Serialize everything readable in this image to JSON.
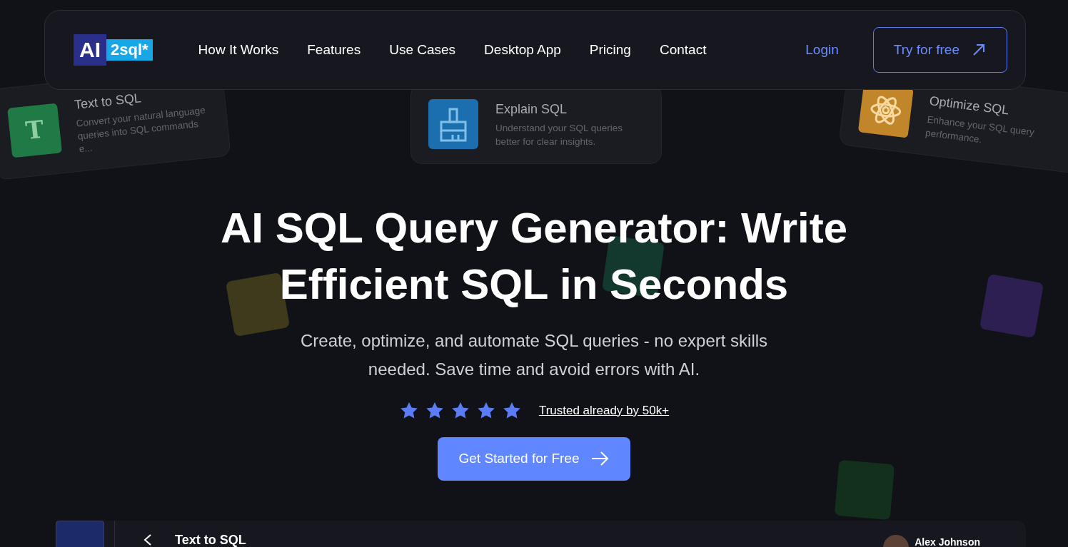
{
  "logo": {
    "part_1": "AI",
    "part_2": "2sql*"
  },
  "nav": {
    "links": [
      {
        "label": "How It Works"
      },
      {
        "label": "Features"
      },
      {
        "label": "Use Cases"
      },
      {
        "label": "Desktop App"
      },
      {
        "label": "Pricing"
      },
      {
        "label": "Contact"
      }
    ],
    "login": "Login",
    "cta": "Try for free"
  },
  "feature_cards": [
    {
      "kind": "letter",
      "glyph": "T",
      "color": "#1f7a45",
      "title": "Text to SQL",
      "description": "Convert your natural language queries into SQL commands e..."
    },
    {
      "kind": "brush",
      "color": "#1b6fae",
      "title": "Explain SQL",
      "description": "Understand your SQL queries better for clear insights."
    },
    {
      "kind": "atom",
      "color": "#c2862a",
      "title": "Optimize SQL",
      "description": "Enhance your SQL query performance."
    }
  ],
  "background_tiles": [
    {
      "color": "#3f3a1c"
    },
    {
      "color": "#13382e"
    },
    {
      "color": "#2e1f52"
    },
    {
      "color": "#12301b"
    }
  ],
  "hero": {
    "title_lines": [
      "AI SQL Query Generator: Write",
      "Efficient SQL in Seconds"
    ],
    "subtitle_lines": [
      "Create, optimize, and automate SQL queries - no expert skills",
      "needed. Save time and avoid errors with AI."
    ],
    "stars": 5,
    "trust": "Trusted already by 50k+",
    "button": "Get Started for Free"
  },
  "preview": {
    "title": "Text to SQL",
    "user": "Alex Johnson"
  }
}
